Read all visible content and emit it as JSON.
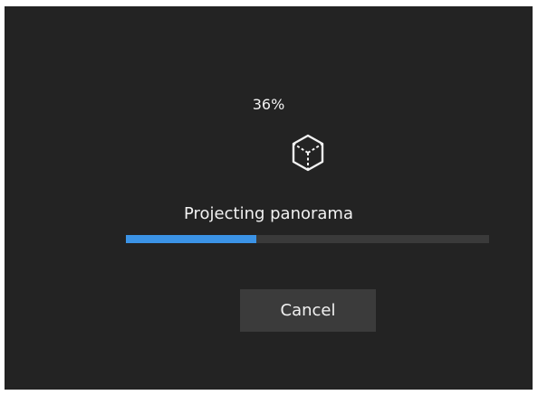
{
  "progress": {
    "percent_label": "36%",
    "fraction": 0.36,
    "status_text": "Projecting panorama"
  },
  "icons": {
    "busy": "cube-icon"
  },
  "colors": {
    "background": "#232323",
    "text": "#f2f2f2",
    "progress_fill": "#3b93e6",
    "progress_track": "#3a3a3a",
    "button": "#3b3b3b"
  },
  "actions": {
    "cancel_label": "Cancel"
  }
}
